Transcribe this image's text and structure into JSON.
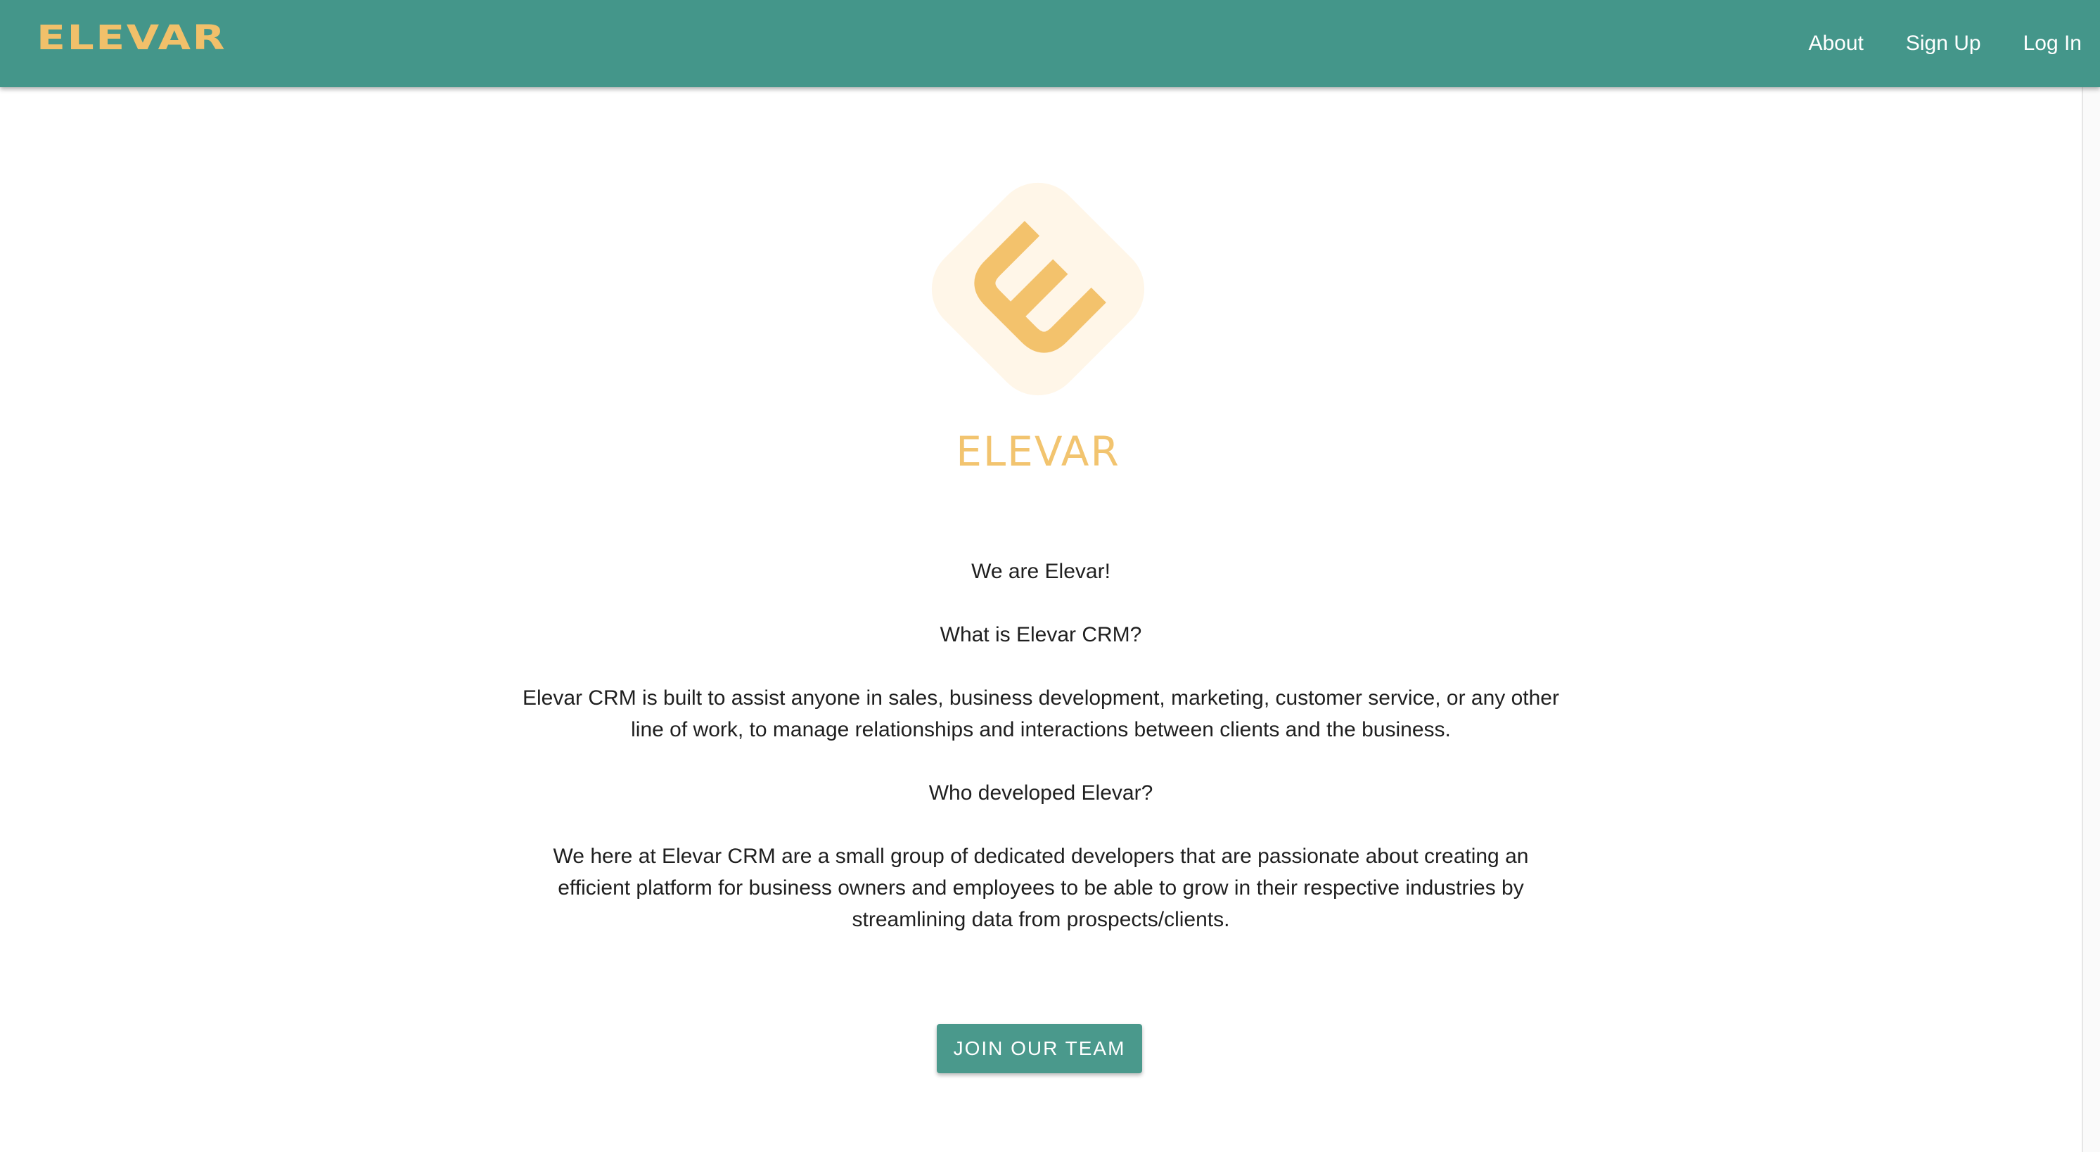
{
  "header": {
    "brand": "ELEVAR",
    "nav": [
      {
        "label": "About"
      },
      {
        "label": "Sign Up"
      },
      {
        "label": "Log In"
      }
    ]
  },
  "hero": {
    "logo_icon": "elevar-e-icon",
    "logo_text": "ELEVAR"
  },
  "content": {
    "intro": "We are Elevar!",
    "q1": "What is Elevar CRM?",
    "a1": "Elevar CRM is built to assist anyone in sales, business development, marketing, customer service, or any other line of work, to manage relationships and interactions between clients and the business.",
    "q2": "Who developed Elevar?",
    "a2": "We here at Elevar CRM are a small group of dedicated developers that are passionate about creating an efficient platform for business owners and employees to be able to grow in their respective industries by streamlining data from prospects/clients."
  },
  "cta": {
    "label": "JOIN OUR TEAM"
  },
  "colors": {
    "header_bg": "#44968a",
    "brand": "#f1c06a",
    "logo_bg": "#fff6e8",
    "logo_fg": "#f3c26c",
    "button_bg": "#4a998c"
  }
}
